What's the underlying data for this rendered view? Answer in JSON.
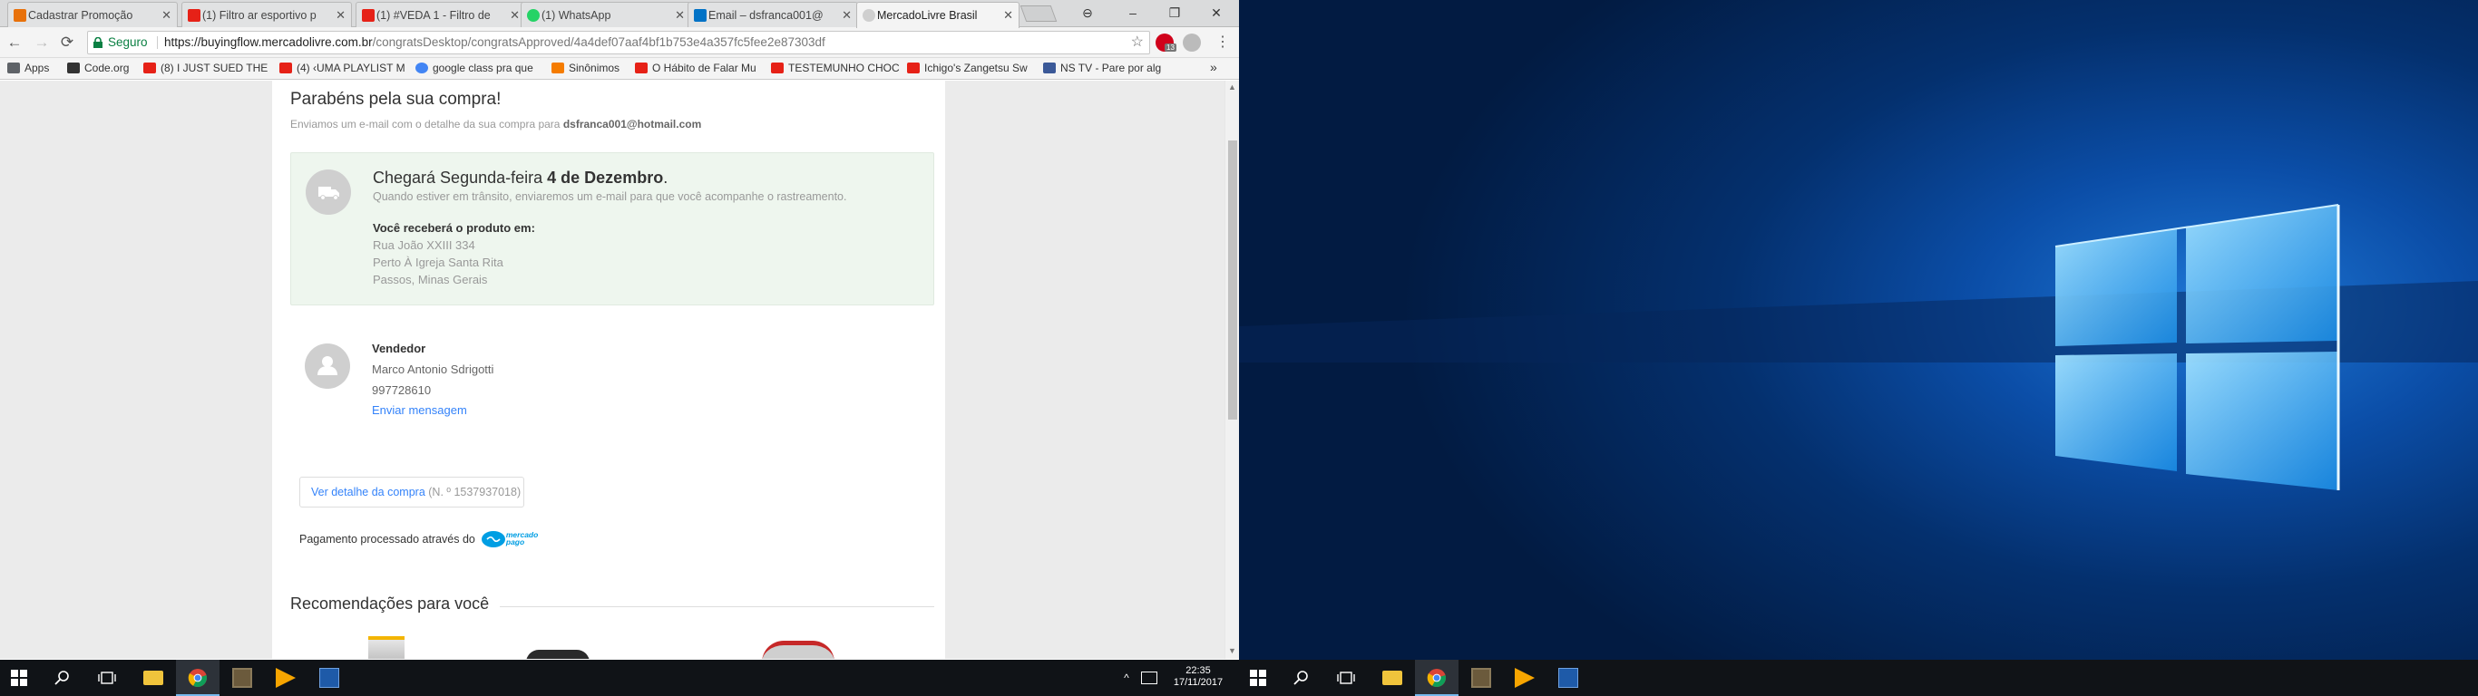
{
  "browser": {
    "tabs": [
      {
        "label": "Cadastrar Promoção",
        "favicon_color": "#e8710a"
      },
      {
        "label": "(1) Filtro ar esportivo p",
        "favicon_color": "#e62117"
      },
      {
        "label": "(1) #VEDA 1 - Filtro de",
        "favicon_color": "#e62117"
      },
      {
        "label": "(1) WhatsApp",
        "favicon_color": "#25d366"
      },
      {
        "label": "Email – dsfranca001@",
        "favicon_color": "#0072c6"
      },
      {
        "label": "MercadoLivre Brasil",
        "favicon_color": "#999999"
      }
    ],
    "window_controls": {
      "user": "⊖",
      "minimize": "–",
      "restore": "❐",
      "close": "✕"
    },
    "nav": {
      "back": "←",
      "forward": "→",
      "reload": "⟳",
      "menu": "⋮"
    },
    "security_label": "Seguro",
    "url_host": "https://buyingflow.mercadolivre.com.br",
    "url_path": "/congratsDesktop/congratsApproved/4a4def07aaf4bf1b753e4a357fc5fee2e87303df",
    "star": "☆",
    "extension_badge": "13",
    "bookmarks": [
      {
        "label": "Apps",
        "color": "#5f6368"
      },
      {
        "label": "Code.org",
        "color": "#333333"
      },
      {
        "label": "(8) I JUST SUED THE",
        "color": "#e62117"
      },
      {
        "label": "(4) ‹UMA PLAYLIST M",
        "color": "#e62117"
      },
      {
        "label": "google class pra que",
        "color": "#4285f4"
      },
      {
        "label": "Sinônimos",
        "color": "#f57c00"
      },
      {
        "label": "O Hábito de Falar Mu",
        "color": "#e62117"
      },
      {
        "label": "TESTEMUNHO CHOC",
        "color": "#e62117"
      },
      {
        "label": "Ichigo's Zangetsu Sw",
        "color": "#e62117"
      },
      {
        "label": "NS TV - Pare por alg",
        "color": "#3b5998"
      }
    ],
    "bookmarks_more": "»"
  },
  "page": {
    "title": "Parabéns pela sua compra!",
    "email_notice": "Enviamos um e-mail com o detalhe da sua compra para",
    "email": "dsfranca001@hotmail.com",
    "shipping": {
      "arrival_prefix": "Chegará Segunda-feira",
      "arrival_date": "4 de Dezembro",
      "arrival_suffix": ".",
      "transit_notice": "Quando estiver em trânsito, enviaremos um e-mail para que você acompanhe o rastreamento.",
      "address_label": "Você receberá o produto em:",
      "address_lines": [
        "Rua João XXIII 334",
        "Perto À Igreja Santa Rita",
        "Passos, Minas Gerais"
      ]
    },
    "seller": {
      "label": "Vendedor",
      "name": "Marco Antonio Sdrigotti",
      "phone": "997728610",
      "message_link": "Enviar mensagem"
    },
    "detail_button": "Ver detalhe da compra",
    "order_number": "(N. º 1537937018)",
    "payment_text": "Pagamento processado através do",
    "payment_brand": "mercado pago",
    "recommendations_title": "Recomendações para você"
  },
  "taskbar": {
    "time": "22:35",
    "date": "17/11/2017",
    "tray_chevron": "^",
    "colors": {
      "chrome": "#4285f4",
      "explorer": "#f0c43c",
      "minecraft": "#6b5a3c",
      "vlc": "#f7a500",
      "blue_app": "#1e5aa8"
    }
  },
  "desktop": {
    "background_color": "#0b4ea8",
    "logo_color": "#6cc6ff"
  }
}
